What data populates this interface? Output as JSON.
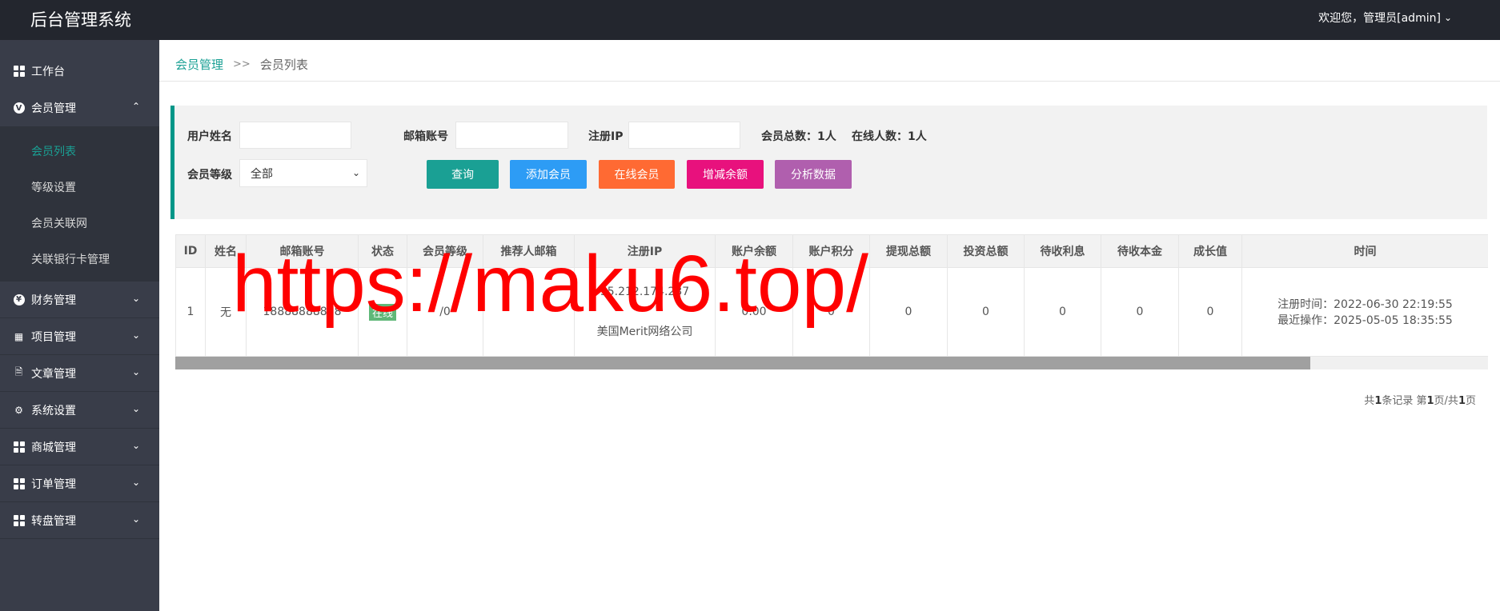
{
  "header": {
    "brand": "后台管理系统",
    "user": "欢迎您，管理员[admin]"
  },
  "sidebar": {
    "items": [
      {
        "label": "工作台",
        "icon": "dashboard-icon"
      },
      {
        "label": "会员管理",
        "icon": "member-icon",
        "expanded": true,
        "children": [
          "会员列表",
          "等级设置",
          "会员关联网",
          "关联银行卡管理"
        ]
      },
      {
        "label": "财务管理",
        "icon": "finance-icon"
      },
      {
        "label": "项目管理",
        "icon": "project-icon"
      },
      {
        "label": "文章管理",
        "icon": "article-icon"
      },
      {
        "label": "系统设置",
        "icon": "gear-icon"
      },
      {
        "label": "商城管理",
        "icon": "shop-icon"
      },
      {
        "label": "订单管理",
        "icon": "order-icon"
      },
      {
        "label": "转盘管理",
        "icon": "wheel-icon"
      }
    ]
  },
  "breadcrumb": {
    "parent": "会员管理",
    "sep": ">>",
    "current": "会员列表"
  },
  "filters": {
    "username_label": "用户姓名",
    "email_label": "邮箱账号",
    "ip_label": "注册IP",
    "total_label": "会员总数：",
    "total_value": "1人",
    "online_label": "在线人数：",
    "online_value": "1人",
    "level_label": "会员等级",
    "level_selected": "全部",
    "buttons": [
      {
        "label": "查询",
        "color": "#1aa094"
      },
      {
        "label": "添加会员",
        "color": "#2d9cf5"
      },
      {
        "label": "在线会员",
        "color": "#ff6a33"
      },
      {
        "label": "增减余额",
        "color": "#e8117d"
      },
      {
        "label": "分析数据",
        "color": "#b05fae"
      }
    ]
  },
  "table": {
    "headers": [
      "ID",
      "姓名",
      "邮箱账号",
      "状态",
      "会员等级",
      "推荐人邮箱",
      "注册IP",
      "账户余额",
      "账户积分",
      "提现总额",
      "投资总额",
      "待收利息",
      "待收本金",
      "成长值",
      "时间"
    ],
    "rows": [
      {
        "id": "1",
        "name": "无",
        "email": "18888888888",
        "status": "在线",
        "level": "/0",
        "ref": "",
        "ip": "35.212.174.237",
        "ip_loc": "美国Merit网络公司",
        "balance": "0.00",
        "points": "0",
        "withdraw": "0",
        "invest": "0",
        "interest": "0",
        "principal": "0",
        "growth": "0",
        "reg_time": "注册时间：2022-06-30 22:19:55",
        "last_time": "最近操作：2025-05-05 18:35:55"
      }
    ]
  },
  "pager": {
    "pre": "共",
    "total": "1",
    "mid": "条记录 第",
    "page": "1",
    "mid2": "页/共",
    "pages": "1",
    "post": "页"
  },
  "watermark": "https://maku6.top/"
}
